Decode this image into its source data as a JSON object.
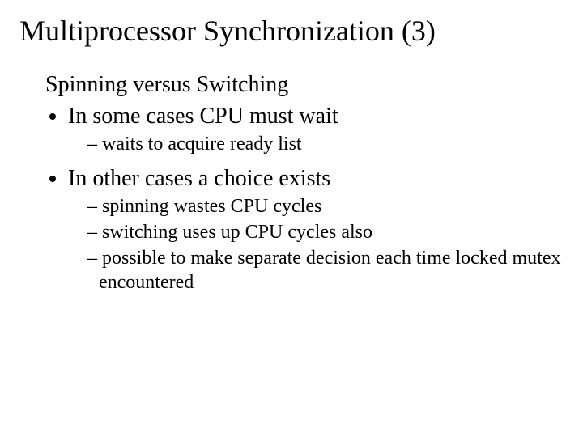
{
  "title": "Multiprocessor Synchronization (3)",
  "intro": "Spinning versus Switching",
  "bullets": [
    {
      "text": "In some cases CPU must wait",
      "sub": [
        "waits to acquire ready list"
      ]
    },
    {
      "text": "In other cases a choice exists",
      "sub": [
        "spinning wastes CPU cycles",
        "switching uses up CPU cycles also",
        "possible to make separate decision each time locked mutex encountered"
      ]
    }
  ]
}
